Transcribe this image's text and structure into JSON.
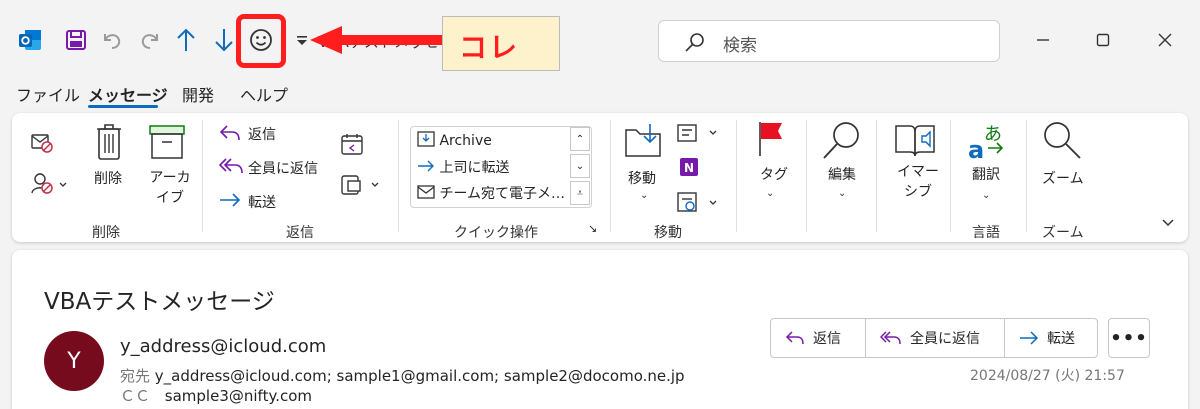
{
  "titlebar": {
    "title": "VBAテストメッセージ - HTML…",
    "search_placeholder": "検索",
    "annotation_label": "コレ"
  },
  "menu": {
    "tabs": [
      "ファイル",
      "メッセージ",
      "開発",
      "ヘルプ"
    ],
    "active": "メッセージ"
  },
  "ribbon": {
    "delete_group": {
      "delete_label": "削除",
      "archive_label": "アーカイブ",
      "group_label": "削除"
    },
    "reply_group": {
      "reply": "返信",
      "reply_all": "全員に返信",
      "forward": "転送",
      "group_label": "返信"
    },
    "quick_steps": {
      "items": [
        "Archive",
        "上司に転送",
        "チーム宛て電子メ…"
      ],
      "group_label": "クイック操作"
    },
    "move_group": {
      "move": "移動",
      "group_label": "移動"
    },
    "tags_group": {
      "tag": "タグ"
    },
    "edit_group": {
      "edit": "編集"
    },
    "immersive_group": {
      "immersive": "イマーシブ"
    },
    "language_group": {
      "translate": "翻訳",
      "group_label": "言語"
    },
    "zoom_group": {
      "zoom": "ズーム",
      "group_label": "ズーム"
    }
  },
  "message": {
    "subject": "VBAテストメッセージ",
    "avatar_initial": "Y",
    "from": "y_address@icloud.com",
    "to_label": "宛先",
    "to": "y_address@icloud.com;  sample1@gmail.com;     sample2@docomo.ne.jp",
    "cc_label": "ＣＣ",
    "cc": "sample3@nifty.com",
    "date": "2024/08/27 (火) 21:57",
    "reply_label": "返信",
    "reply_all_label": "全員に返信",
    "forward_label": "転送",
    "more_label": "•••"
  },
  "colors": {
    "accent": "#0f6cbd",
    "annotation_red": "#ff1d1d",
    "note_bg": "#fef2cc",
    "avatar_bg": "#750b1c",
    "onenote_purple": "#7719aa",
    "flag_red": "#e81123"
  }
}
